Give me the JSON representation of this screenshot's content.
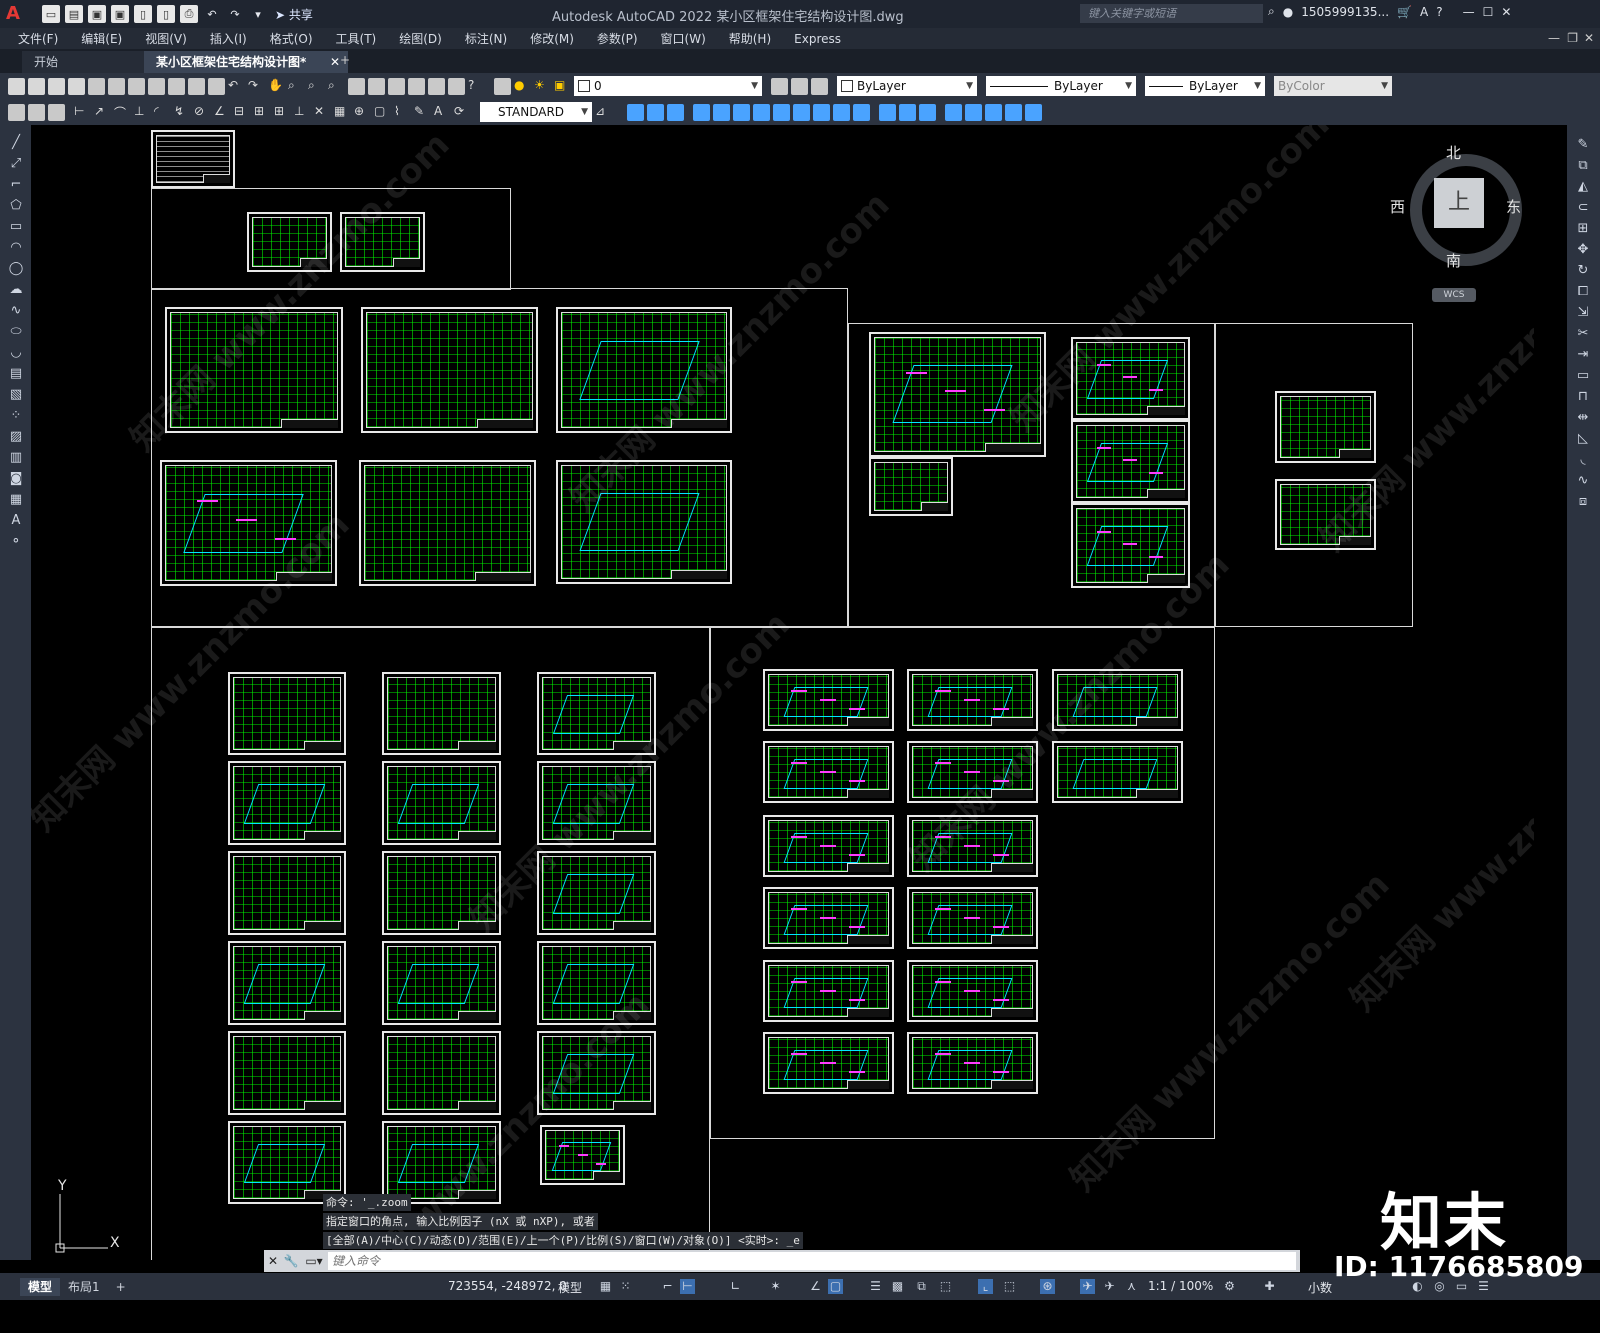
{
  "app": {
    "logo_letter": "A",
    "title": "Autodesk AutoCAD 2022    某小区框架住宅结构设计图.dwg",
    "share_label": "共享",
    "search_placeholder": "键入关键字或短语",
    "user": "1505999135...",
    "window_controls": [
      "—",
      "☐",
      "✕"
    ]
  },
  "menu": [
    "文件(F)",
    "编辑(E)",
    "视图(V)",
    "插入(I)",
    "格式(O)",
    "工具(T)",
    "绘图(D)",
    "标注(N)",
    "修改(M)",
    "参数(P)",
    "窗口(W)",
    "帮助(H)",
    "Express"
  ],
  "tabs": {
    "start": "开始",
    "drawing": "某小区框架住宅结构设计图*",
    "close": "✕",
    "add": "+"
  },
  "toolbar": {
    "layer_value": "0",
    "color_value": "ByLayer",
    "linetype_value": "ByLayer",
    "lineweight_value": "ByLayer",
    "plotstyle_value": "ByColor",
    "textstyle_value": "STANDARD"
  },
  "viewcube": {
    "north": "北",
    "south": "南",
    "west": "西",
    "east": "东",
    "face": "上",
    "wcs": "WCS"
  },
  "ucs": {
    "x": "X",
    "y": "Y"
  },
  "command": {
    "history": [
      "命令: '_.zoom",
      "指定窗口的角点, 输入比例因子 (nX 或 nXP), 或者",
      "[全部(A)/中心(C)/动态(D)/范围(E)/上一个(P)/比例(S)/窗口(W)/对象(O)] <实时>: _e"
    ],
    "placeholder": "键入命令"
  },
  "status": {
    "model_tab": "模型",
    "layout_tab": "布局1",
    "add_tab": "+",
    "coordinates": "723554, -248972, 0",
    "model_label": "模型",
    "annotation_scale": "1:1 / 100%",
    "units": "小数"
  },
  "watermark": {
    "brand": "知末",
    "id": "ID: 1176685809",
    "site": "www.znzmo.com",
    "site_cn": "知末网"
  },
  "colors": {
    "ui_bg": "#2c3340",
    "canvas": "#000000",
    "drawing_green": "#00ff00",
    "drawing_cyan": "#00e5ff",
    "drawing_magenta": "#ff3dff",
    "accent_red": "#e53935"
  }
}
